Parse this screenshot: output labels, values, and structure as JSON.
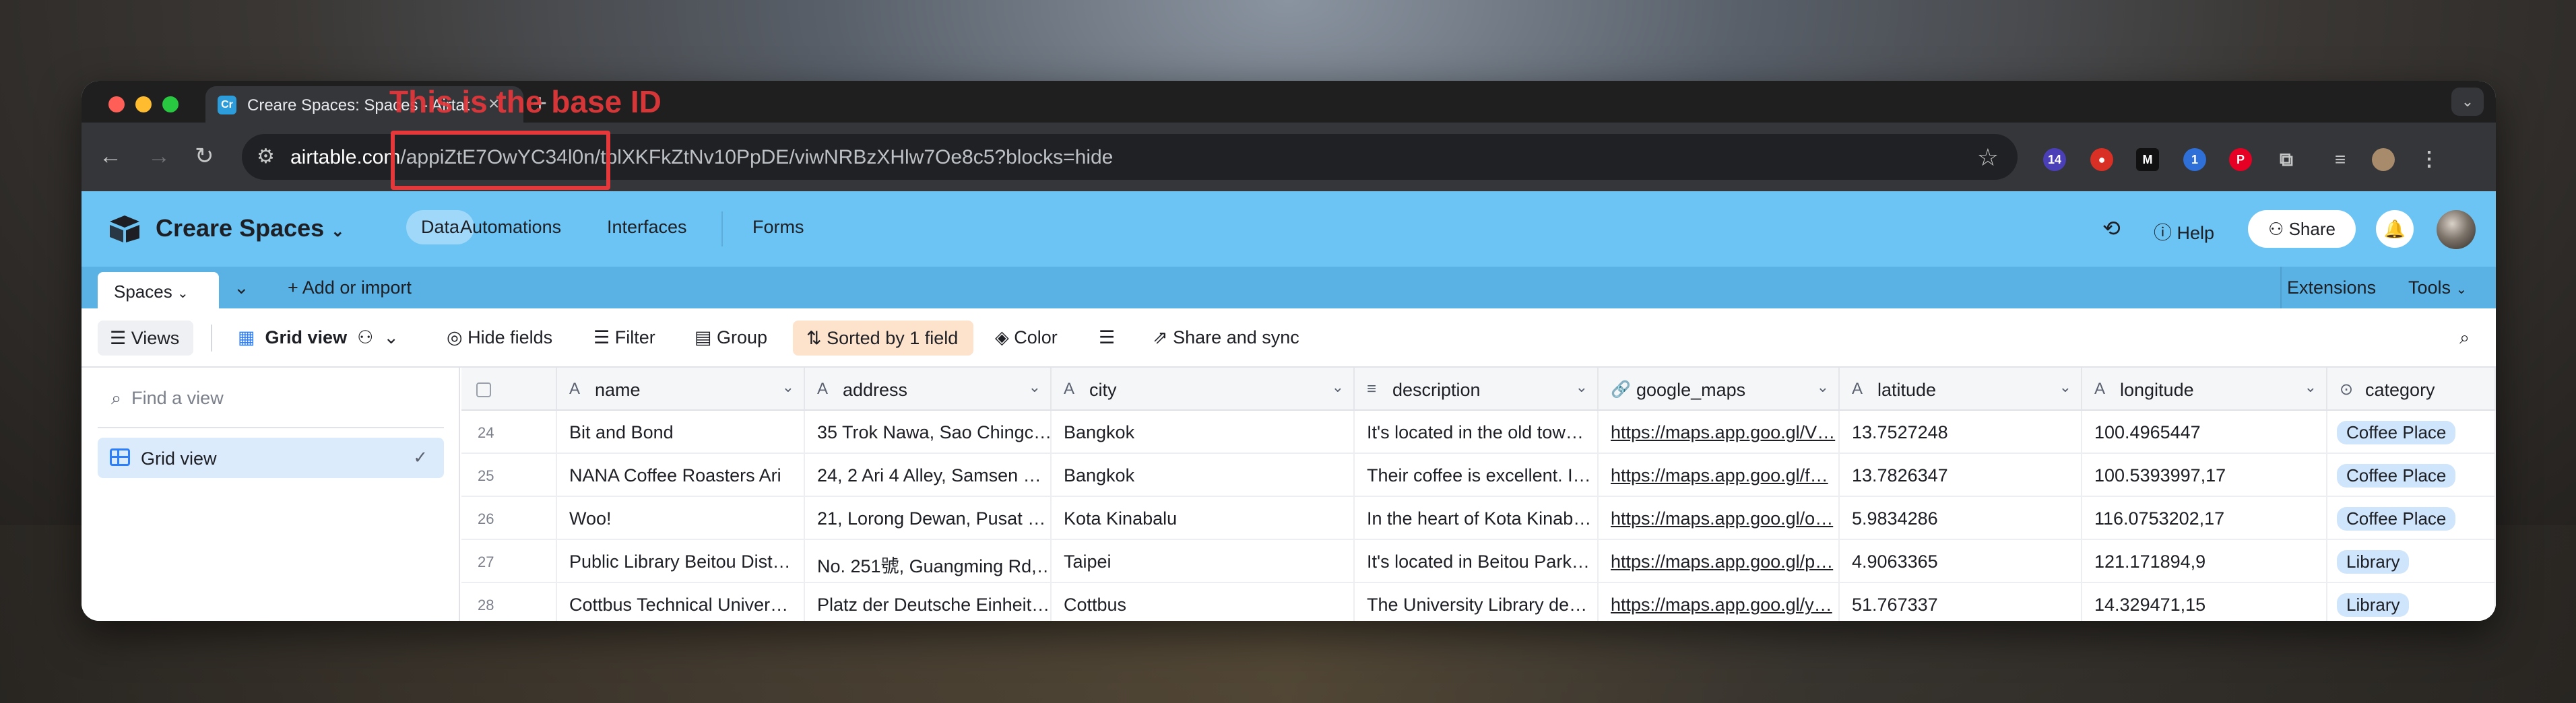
{
  "annotation": {
    "label": "This is the base ID",
    "color": "#e5383b"
  },
  "browser": {
    "tab_title": "Creare Spaces: Spaces - Airtable",
    "favicon_text": "Cr",
    "url_host": "airtable.com",
    "url_path": "/appiZtE7OwYC34l0n/tblXKFkZtNv10PpDE/viwNRBzXHlw7Oe8c5?blocks=hide",
    "extension_badge": "14"
  },
  "header": {
    "base_name": "Creare Spaces",
    "nav": [
      "Data",
      "Automations",
      "Interfaces",
      "Forms"
    ],
    "help_label": "Help",
    "share_label": "Share",
    "background": "#6cc4f5"
  },
  "tables_bar": {
    "active_table": "Spaces",
    "add_label": "Add or import",
    "extensions_label": "Extensions",
    "tools_label": "Tools"
  },
  "view_bar": {
    "views_label": "Views",
    "view_name": "Grid view",
    "hide_fields": "Hide fields",
    "filter": "Filter",
    "group": "Group",
    "sorted": "Sorted by 1 field",
    "color": "Color",
    "share_sync": "Share and sync"
  },
  "sidebar": {
    "search_placeholder": "Find a view",
    "views": [
      "Grid view"
    ]
  },
  "grid": {
    "columns": [
      "name",
      "address",
      "city",
      "description",
      "google_maps",
      "latitude",
      "longitude",
      "category"
    ],
    "rows": [
      {
        "num": "24",
        "name": "Bit and Bond",
        "address": "35 Trok Nawa, Sao Chingc…",
        "city": "Bangkok",
        "description": "It's located in the old tow…",
        "google_maps": "https://maps.app.goo.gl/V…",
        "latitude": "13.7527248",
        "longitude": "100.4965447",
        "category": "Coffee Place"
      },
      {
        "num": "25",
        "name": "NANA Coffee Roasters Ari",
        "address": "24, 2 Ari 4 Alley, Samsen …",
        "city": "Bangkok",
        "description": "Their coffee is excellent. I…",
        "google_maps": "https://maps.app.goo.gl/f…",
        "latitude": "13.7826347",
        "longitude": "100.5393997,17",
        "category": "Coffee Place"
      },
      {
        "num": "26",
        "name": "Woo!",
        "address": "21, Lorong Dewan, Pusat …",
        "city": "Kota Kinabalu",
        "description": "In the heart of Kota Kinab…",
        "google_maps": "https://maps.app.goo.gl/o…",
        "latitude": "5.9834286",
        "longitude": "116.0753202,17",
        "category": "Coffee Place"
      },
      {
        "num": "27",
        "name": "Public Library Beitou Dist…",
        "address": "No. 251號, Guangming Rd,…",
        "city": "Taipei",
        "description": "It's located in Beitou Park…",
        "google_maps": "https://maps.app.goo.gl/p…",
        "latitude": "4.9063365",
        "longitude": "121.171894,9",
        "category": "Library"
      },
      {
        "num": "28",
        "name": "Cottbus Technical Univer…",
        "address": "Platz der Deutsche Einheit…",
        "city": "Cottbus",
        "description": "The University Library de…",
        "google_maps": "https://maps.app.goo.gl/y…",
        "latitude": "51.767337",
        "longitude": "14.329471,15",
        "category": "Library"
      }
    ]
  }
}
